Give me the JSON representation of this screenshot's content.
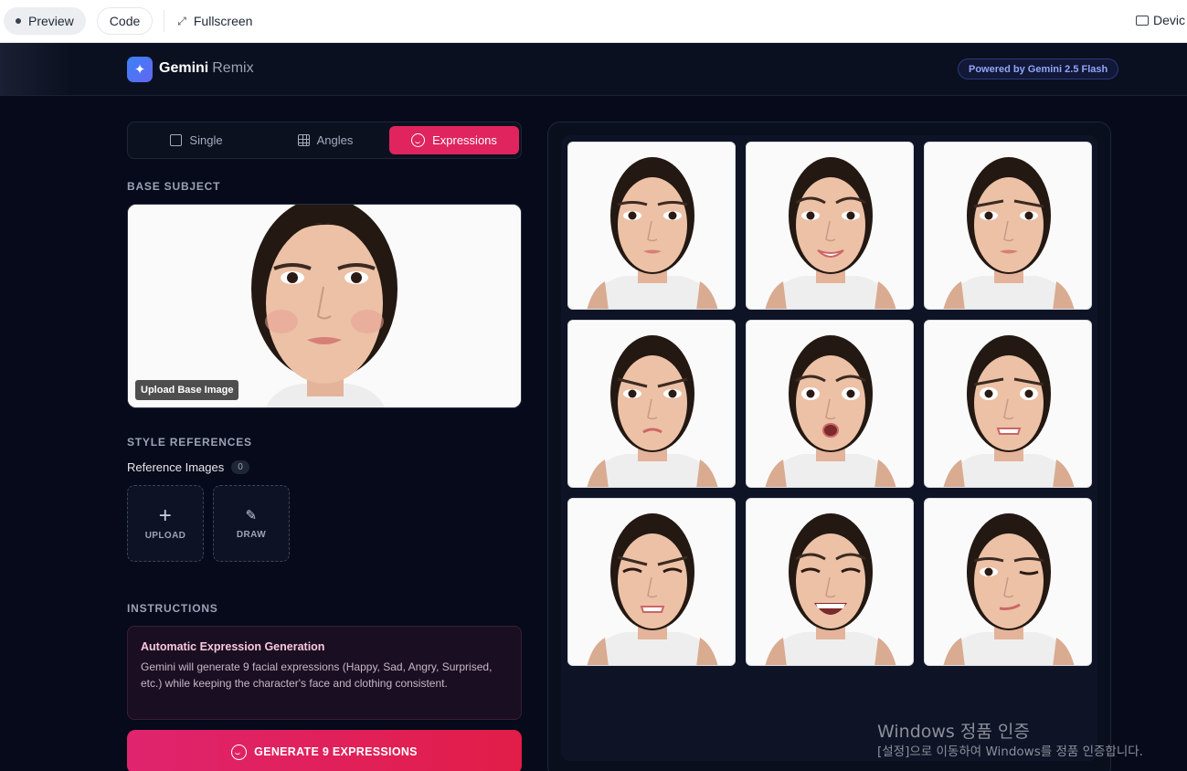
{
  "toolbar": {
    "preview_label": "Preview",
    "code_label": "Code",
    "fullscreen_label": "Fullscreen",
    "device_label": "Devic"
  },
  "header": {
    "brand": "Gemini",
    "brand_sub": "Remix",
    "powered_by": "Powered by Gemini 2.5 Flash"
  },
  "tabs": [
    {
      "label": "Single",
      "icon": "square-icon"
    },
    {
      "label": "Angles",
      "icon": "grid-icon"
    },
    {
      "label": "Expressions",
      "icon": "smile-icon",
      "active": true
    }
  ],
  "base_subject": {
    "heading": "BASE SUBJECT",
    "upload_label": "Upload Base Image"
  },
  "style_references": {
    "heading": "STYLE REFERENCES",
    "ref_label": "Reference Images",
    "ref_count": "0",
    "upload_label": "UPLOAD",
    "draw_label": "DRAW"
  },
  "instructions": {
    "heading": "INSTRUCTIONS",
    "title": "Automatic Expression Generation",
    "text": "Gemini will generate 9 facial expressions (Happy, Sad, Angry, Surprised, etc.) while keeping the character's face and clothing consistent."
  },
  "generate_button": "GENERATE 9 EXPRESSIONS",
  "colors": {
    "accent": "#e0245e",
    "background": "#060a1a",
    "panel": "#0a0f1e"
  },
  "expressions": [
    {
      "eyebrow": "neutral",
      "mouth": "neutral",
      "eyes": "open"
    },
    {
      "eyebrow": "raised",
      "mouth": "smile",
      "eyes": "open"
    },
    {
      "eyebrow": "worried",
      "mouth": "neutral",
      "eyes": "open"
    },
    {
      "eyebrow": "angry",
      "mouth": "frown",
      "eyes": "open"
    },
    {
      "eyebrow": "raised",
      "mouth": "o",
      "eyes": "wide"
    },
    {
      "eyebrow": "worried",
      "mouth": "grimace",
      "eyes": "wide"
    },
    {
      "eyebrow": "angry",
      "mouth": "grimace",
      "eyes": "squint"
    },
    {
      "eyebrow": "raised",
      "mouth": "laugh",
      "eyes": "squint"
    },
    {
      "eyebrow": "neutral",
      "mouth": "smirk",
      "eyes": "wink"
    }
  ],
  "watermark": {
    "line1": "Windows 정품 인증",
    "line2": "[설정]으로 이동하여 Windows를 정품 인증합니다."
  }
}
